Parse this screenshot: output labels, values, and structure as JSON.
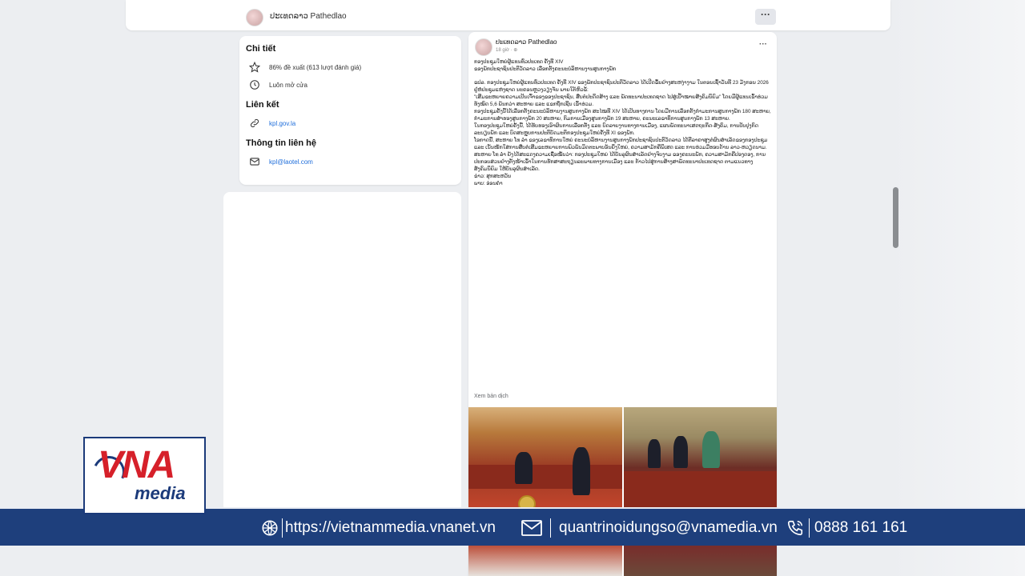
{
  "page": {
    "name": "ປະເທດລາວ Pathedlao"
  },
  "info": {
    "details_title": "Chi tiết",
    "rating": "86% đề xuất (613 lượt đánh giá)",
    "hours": "Luôn mở cửa",
    "links_title": "Liên kết",
    "website": "kpl.gov.la",
    "contact_title": "Thông tin liên hệ",
    "email": "kpl@laotel.com"
  },
  "post": {
    "author": "ປະເທດລາວ Pathedlao",
    "time": "18 giờ · ⊕",
    "lines": [
      "ກອງປະຊຸມໃຫຍ່ຜູ້ແທນທົ່ວປະເທດ ຄັ້ງທີ XIV",
      "ຂອງພັກປະຊາຊົນປະຕິວັດລາວ ເລືອກຕັ້ງຄະນະບໍລິຫານງານສູນກາງພັກ"
    ],
    "body": [
      "ຂປລ. ກອງປະຊຸມໃຫຍ່ຜູ້ແທນທົ່ວປະເທດ ຄັ້ງທີ XIV ຂອງພັກປະຊາຊົນປະຕິວັດລາວ ໄດ້ເປີດຂຶ້ນຢ່າງສະຫງ່າງາມ ໃນຕອນເຊົ້າວັນທີ 23 ມັງກອນ 2026 ຢູ່ຫໍປະຊຸມແຫ່ງຊາດ ນະຄອນຫຼວງວຽງຈັນ ພາຍໃຕ້ຫົວຂໍ້:",
      "\"ເສີມຂະຫຍາຍຄວາມເປັນເຈົ້າຂອງຂອງປະຊາຊົນ, ສືບຕໍ່ປະດິດສ້າງ ແລະ ພັດທະນາປະເທດຊາດ ໄປສູ່ເປົ້າໝາຍສັງຄົມນິຍົມ\" ໂດຍມີຜູ້ແທນເຂົ້າຮ່ວມທັງໝົດ 5,6 ພັນກວ່າ ສະຫາຍ ແລະ ແຂກຖືກເຊີນ ເຂົ້າຮ່ວມ.",
      "ກອງປະຊຸມຄັ້ງນີ້ໄດ້ເລືອກຕັ້ງຄະນະບໍລິຫານງານສູນກາງພັກ ສະໄໝທີ XIV ໄດ້ເປັນທາງການ ໂດຍມີການເລືອກຕັ້ງກຳມະການສູນກາງພັກ 180 ສະຫາຍ, ກຳມະການສຳຮອງສູນກາງພັກ 20 ສະຫາຍ, ກົມການເມືອງສູນກາງພັກ 19 ສະຫາຍ, ຄະນະເລຂາທິການສູນກາງພັກ 13 ສະຫາຍ.",
      "ໃນກອງປະຊຸມໃຫຍ່ຄັ້ງນີ້, ໄດ້ຮັບຮອງເອົາຜົນການເລືອກຕັ້ງ ແລະ ບົດລາຍງານທາງການເມືອງ, ແຜນພັດທະນາເສດຖະກິດ-ສັງຄົມ, ການປັບປຸງກົດລະບຽບພັກ ແລະ ບົດສະຫຼຸບການປະຕິບັດມະຕິກອງປະຊຸມໃຫຍ່ຄັ້ງທີ XI ຂອງພັກ.",
      "ໂອກາດນີ້, ສະຫາຍ ໂທ ລຳ ຂອງເລຂາທິການໃຫຍ່ ຄະນະບໍລິຫານງານສູນກາງພັກປະຊາຊົນປະຕິວັດລາວ ໄດ້ຕີລາຄາສູງຕໍ່ຜົນສຳເລັດຂອງກອງປະຊຸມ ແລະ ເນັ້ນໜັກໃສ່ການສືບຕໍ່ເສີມຂະຫຍາຍການພົວພັນມິດຕະພາບອັນຍິ່ງໃຫຍ່, ຄວາມສາມັກຄີພິເສດ ແລະ ການຮ່ວມມືຮອບດ້ານ ລາວ-ຫວຽດນາມ.",
      "ສະຫາຍ ໂທ ລຳ ຍັງໄດ້ສະແດງຄວາມເຊື່ອໝັ້ນວ່າ: ກອງປະຊຸມໃຫຍ່ ໄດ້ບັນລຸຜົນສຳເລັດຢ່າງຈົບງາມ ຂອງຄະນະພັກ, ຄວາມສາມັກຄີປອງດອງ, ການປະກອບສ່ວນຢ່າງຕັ້ງໜ້າເຂົ້າໃນການຮັກສາສະຖຽນລະພາບທາງການເມືອງ ແລະ ກ້າວໄປສູ່ການສ້າງສາພັດທະນາປະເທດຊາດ ຕາມແນວທາງສັງຄົມນິຍົມ ໃຫ້ບັນລຸຜົນສຳເລັດ.",
      "ຂ່າວ: ສຸກສະຫວັນ",
      "ພາບ: ອ່ອນຄຳ"
    ],
    "see_translation": "Xem bản dịch"
  },
  "banner": {
    "website": "https://vietnammedia.vnanet.vn",
    "email": "quantrinoidungso@vnamedia.vn",
    "phone": "0888 161 161",
    "bg_color": "#1e3f7c"
  },
  "logo": {
    "brand": "VNA",
    "sub": "media",
    "red": "#d6202a",
    "blue": "#1b3a7a"
  }
}
